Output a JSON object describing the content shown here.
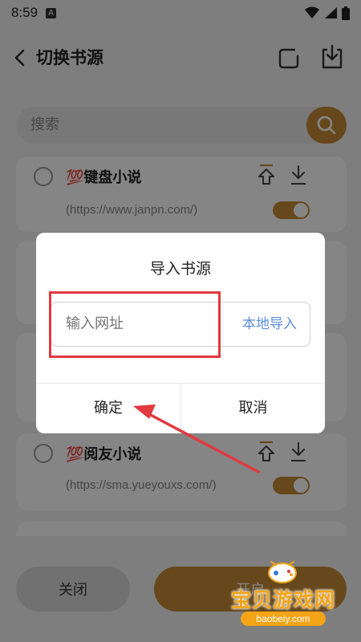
{
  "status_bar": {
    "time": "8:59",
    "notification_badge": "A"
  },
  "header": {
    "title": "切换书源"
  },
  "search": {
    "placeholder": "搜索"
  },
  "sources": [
    {
      "name": "💯键盘小说",
      "url": "(https://www.janpn.com/)",
      "enabled": true
    },
    {
      "name": "💯阅友小说",
      "url": "(https://sma.yueyouxs.com/)",
      "enabled": true
    }
  ],
  "bottom": {
    "close_label": "关闭",
    "open_label": "开启"
  },
  "dialog": {
    "title": "导入书源",
    "url_placeholder": "输入网址",
    "local_import_label": "本地导入",
    "confirm_label": "确定",
    "cancel_label": "取消"
  },
  "watermark": {
    "main": "宝贝游戏网",
    "sub": "baobeiy.com"
  },
  "colors": {
    "accent": "#c38a37",
    "link": "#5b8fd8",
    "annotation": "#e0393f",
    "watermark": "#f3a417"
  }
}
